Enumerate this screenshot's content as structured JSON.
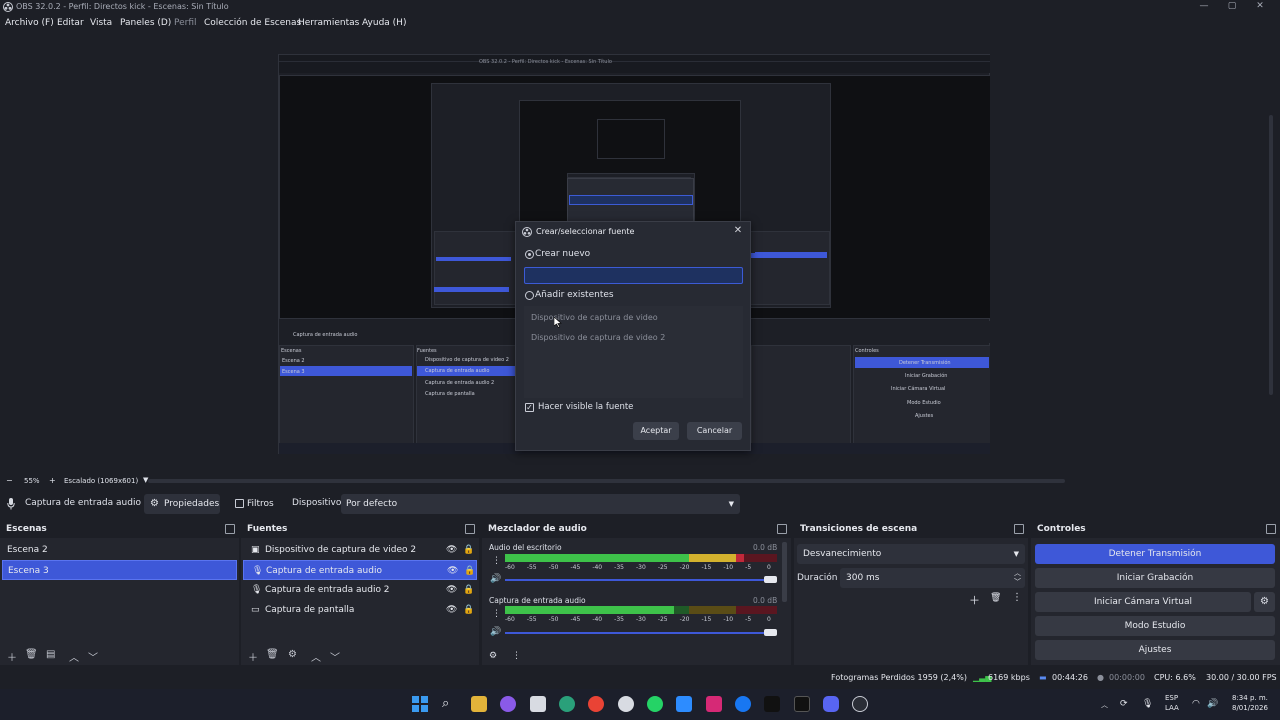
{
  "window": {
    "title": "OBS 32.0.2 - Perfil: Directos kick - Escenas: Sin Título"
  },
  "menu": [
    "Archivo (F)",
    "Editar",
    "Vista",
    "Paneles (D)",
    "Perfil",
    "Colección de Escenas",
    "Herramientas",
    "Ayuda (H)"
  ],
  "dialog": {
    "title": "Crear/seleccionar fuente",
    "create_new": "Crear nuevo",
    "add_existing": "Añadir existentes",
    "existing_items": [
      "Dispositivo de captura de video",
      "Dispositivo de captura de video 2"
    ],
    "make_visible": "Hacer visible la fuente",
    "ok": "Aceptar",
    "cancel": "Cancelar"
  },
  "zoom": {
    "minus": "−",
    "value": "55%",
    "plus": "+",
    "scaling": "Escalado (1069x601)"
  },
  "source_toolbar": {
    "source_name": "Captura de entrada audio",
    "properties": "Propiedades",
    "filters": "Filtros",
    "device_label": "Dispositivo",
    "device_value": "Por defecto"
  },
  "scenes": {
    "title": "Escenas",
    "items": [
      {
        "name": "Escena 2",
        "selected": false
      },
      {
        "name": "Escena 3",
        "selected": true
      }
    ]
  },
  "sources": {
    "title": "Fuentes",
    "items": [
      {
        "name": "Dispositivo de captura de video 2",
        "icon": "camera-icon",
        "selected": false
      },
      {
        "name": "Captura de entrada audio",
        "icon": "microphone-icon",
        "selected": true
      },
      {
        "name": "Captura de entrada audio 2",
        "icon": "microphone-icon",
        "selected": false
      },
      {
        "name": "Captura de pantalla",
        "icon": "monitor-icon",
        "selected": false
      }
    ]
  },
  "mixer": {
    "title": "Mezclador de audio",
    "channels": [
      {
        "name": "Audio del escritorio",
        "db": "0.0 dB",
        "level": 0.88
      },
      {
        "name": "Captura de entrada audio",
        "db": "0.0 dB",
        "level": 0.62
      }
    ],
    "scale": [
      "-60",
      "-55",
      "-50",
      "-45",
      "-40",
      "-35",
      "-30",
      "-25",
      "-20",
      "-15",
      "-10",
      "-5",
      "0"
    ]
  },
  "transitions": {
    "title": "Transiciones de escena",
    "selected": "Desvanecimiento",
    "duration_label": "Duración",
    "duration_value": "300 ms"
  },
  "controls": {
    "title": "Controles",
    "stop_streaming": "Detener Transmisión",
    "start_recording": "Iniciar Grabación",
    "virtual_camera": "Iniciar Cámara Virtual",
    "studio_mode": "Modo Estudio",
    "settings": "Ajustes"
  },
  "status": {
    "dropped_frames": "Fotogramas Perdidos 1959 (2,4%)",
    "bitrate": "6169 kbps",
    "stream_time": "00:44:26",
    "rec_time": "00:00:00",
    "cpu": "CPU: 6.6%",
    "fps": "30.00 / 30.00 FPS"
  },
  "taskbar": {
    "lang1": "ESP",
    "lang2": "LAA",
    "time": "8:34 p. m.",
    "date": "8/01/2026"
  },
  "colors": {
    "accent": "#3e58d8",
    "meter_green": "#3ec24a",
    "meter_yellow": "#d4b22e",
    "meter_red": "#c2283a"
  }
}
